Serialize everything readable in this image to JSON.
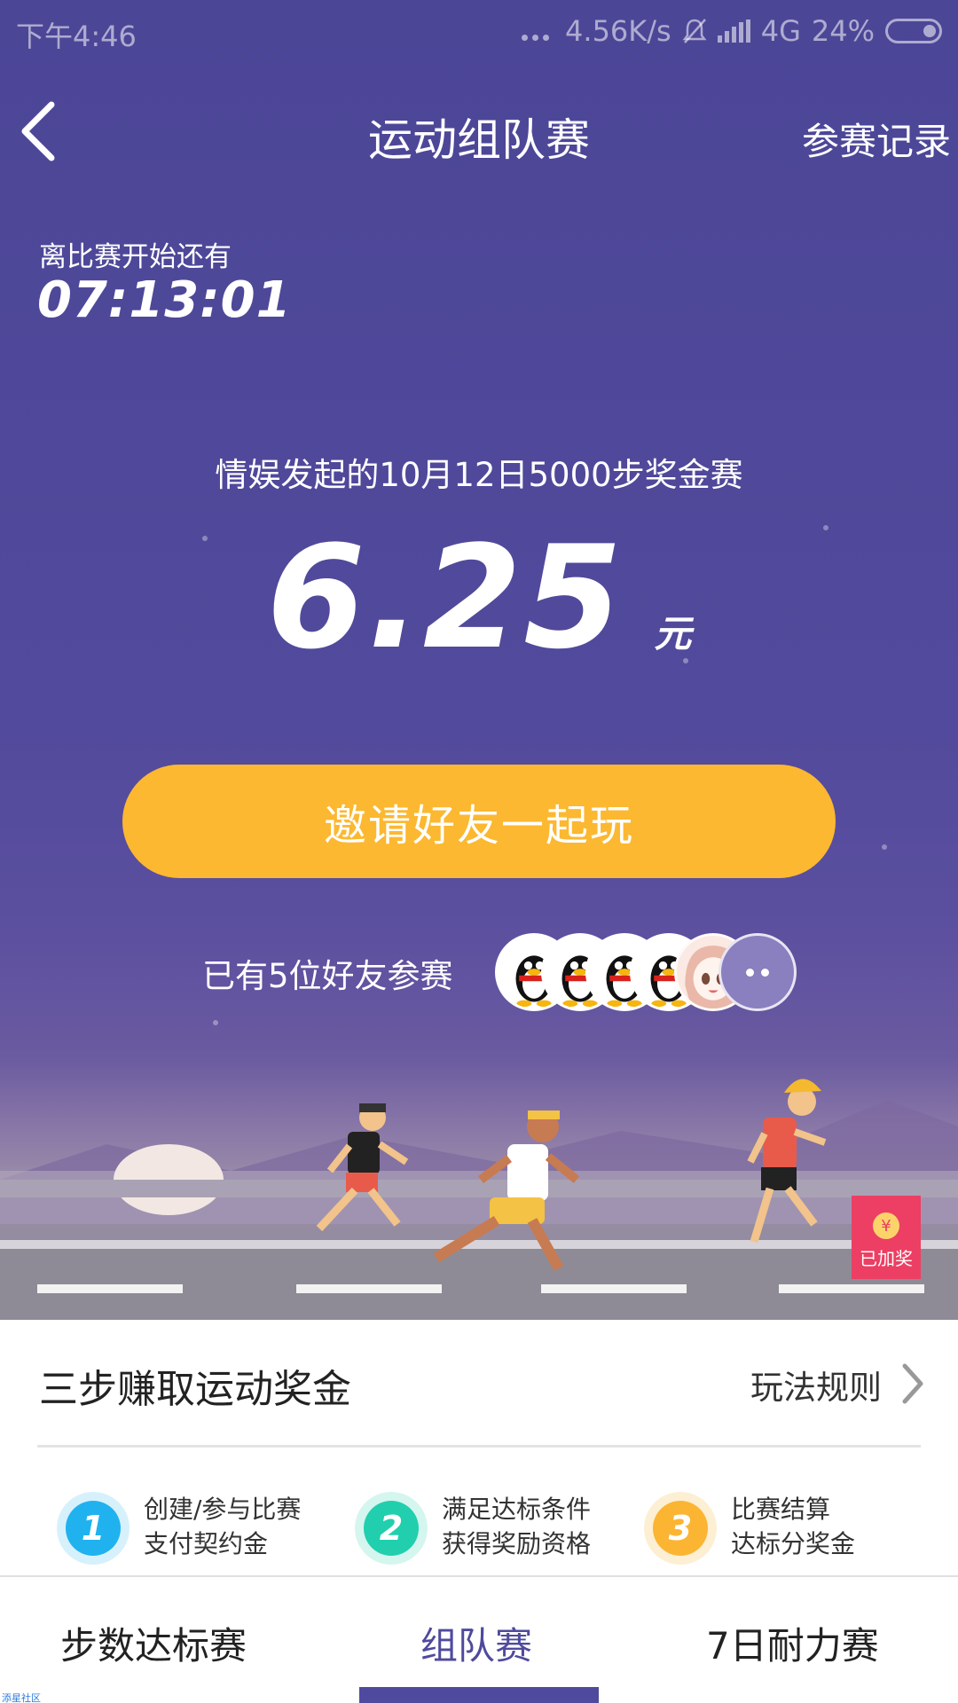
{
  "status_bar": {
    "time": "下午4:46",
    "speed": "4.56K/s",
    "network": "4G",
    "battery": "24%"
  },
  "nav": {
    "title": "运动组队赛",
    "right_link": "参赛记录"
  },
  "countdown": {
    "label": "离比赛开始还有",
    "value": "07:13:01"
  },
  "match": {
    "title": "情娱发起的10月12日5000步奖金赛",
    "amount": "6.25",
    "unit": "元"
  },
  "invite_button": "邀请好友一起玩",
  "friends": {
    "text": "已有5位好友参赛",
    "avatars": [
      "qq-penguin",
      "qq-penguin",
      "qq-penguin",
      "qq-penguin",
      "anime-girl"
    ]
  },
  "reward_badge": {
    "icon": "¥",
    "label": "已加奖"
  },
  "steps_section": {
    "title": "三步赚取运动奖金",
    "rules_link": "玩法规则",
    "steps": [
      {
        "number": "1",
        "line1": "创建/参与比赛",
        "line2": "支付契约金",
        "color": "#1fb2ef",
        "ring": "#d6f1fb"
      },
      {
        "number": "2",
        "line1": "满足达标条件",
        "line2": "获得奖励资格",
        "color": "#21cfae",
        "ring": "#d4f6ee"
      },
      {
        "number": "3",
        "line1": "比赛结算",
        "line2": "达标分奖金",
        "color": "#fbb532",
        "ring": "#fdefd3"
      }
    ]
  },
  "tabs": [
    {
      "label": "步数达标赛",
      "active": false
    },
    {
      "label": "组队赛",
      "active": true
    },
    {
      "label": "7日耐力赛",
      "active": false
    }
  ],
  "watermark": "添星社区"
}
